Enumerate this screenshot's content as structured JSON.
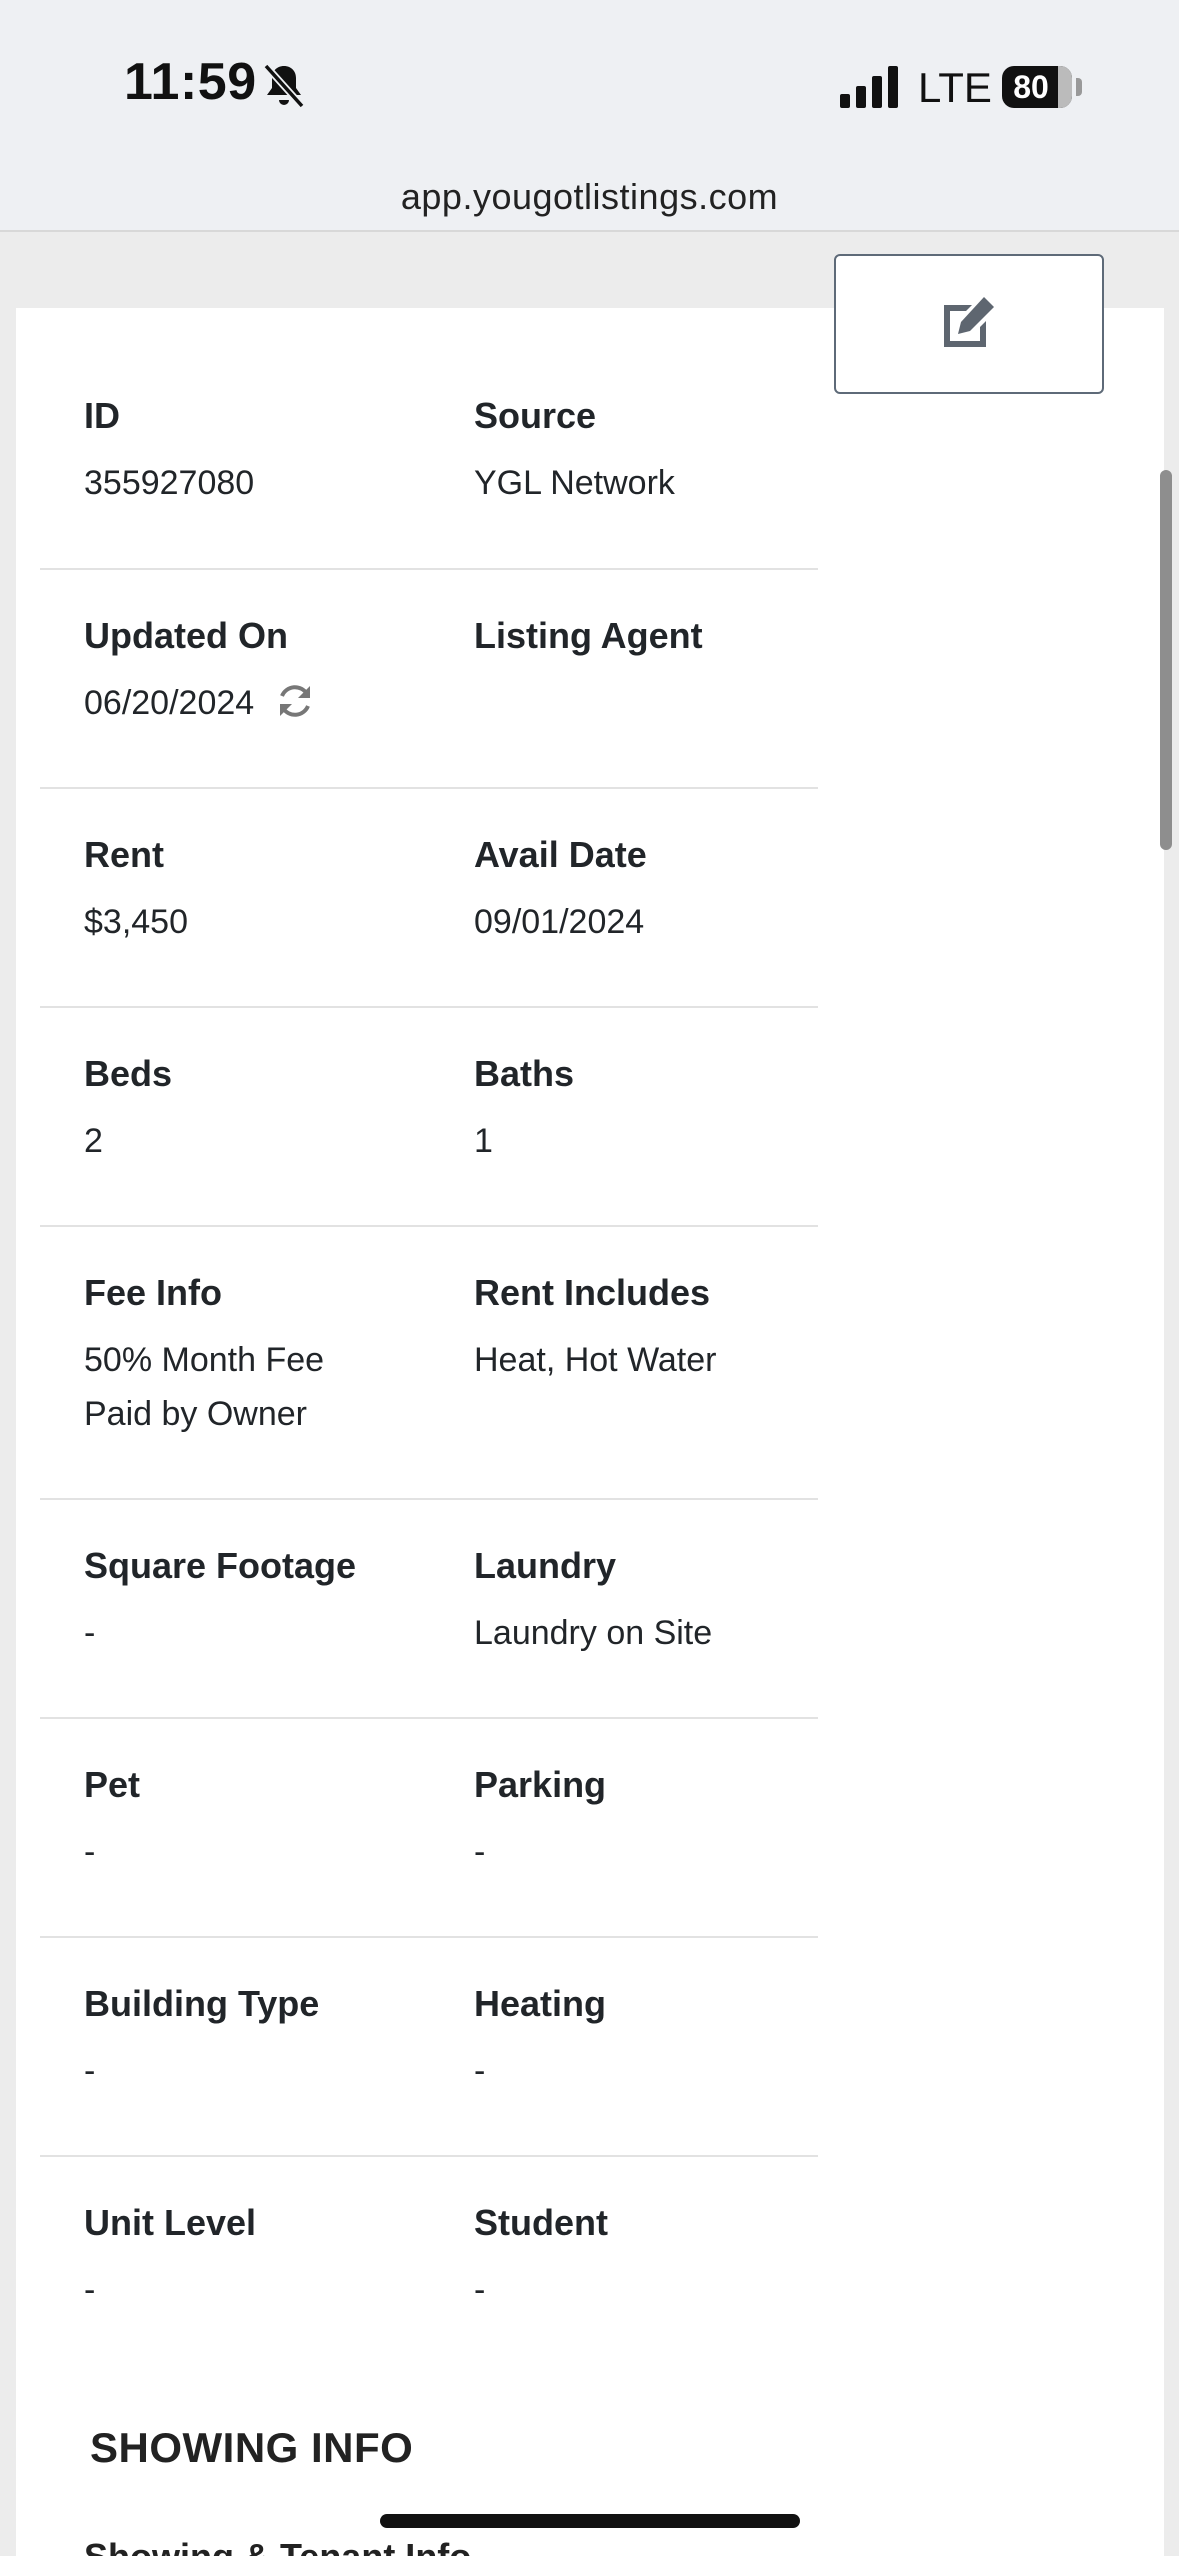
{
  "status_bar": {
    "time": "11:59",
    "network": "LTE",
    "battery": "80",
    "url": "app.yougotlistings.com"
  },
  "details": [
    {
      "left": {
        "label": "ID",
        "value": "355927080"
      },
      "right": {
        "label": "Source",
        "value": "YGL Network"
      }
    },
    {
      "left": {
        "label": "Updated On",
        "value": "06/20/2024"
      },
      "right": {
        "label": "Listing Agent",
        "value": ""
      }
    },
    {
      "left": {
        "label": "Rent",
        "value": "$3,450"
      },
      "right": {
        "label": "Avail Date",
        "value": "09/01/2024"
      }
    },
    {
      "left": {
        "label": "Beds",
        "value": "2"
      },
      "right": {
        "label": "Baths",
        "value": "1"
      }
    },
    {
      "left": {
        "label": "Fee Info",
        "value": "50% Month Fee Paid by Owner"
      },
      "right": {
        "label": "Rent Includes",
        "value": "Heat, Hot Water"
      }
    },
    {
      "left": {
        "label": "Square Footage",
        "value": "-"
      },
      "right": {
        "label": "Laundry",
        "value": "Laundry on Site"
      }
    },
    {
      "left": {
        "label": "Pet",
        "value": "-"
      },
      "right": {
        "label": "Parking",
        "value": "-"
      }
    },
    {
      "left": {
        "label": "Building Type",
        "value": "-"
      },
      "right": {
        "label": "Heating",
        "value": "-"
      }
    },
    {
      "left": {
        "label": "Unit Level",
        "value": "-"
      },
      "right": {
        "label": "Student",
        "value": "-"
      }
    }
  ],
  "section_heading": "SHOWING INFO",
  "next_section_partial": "Showing & Tenant Info"
}
